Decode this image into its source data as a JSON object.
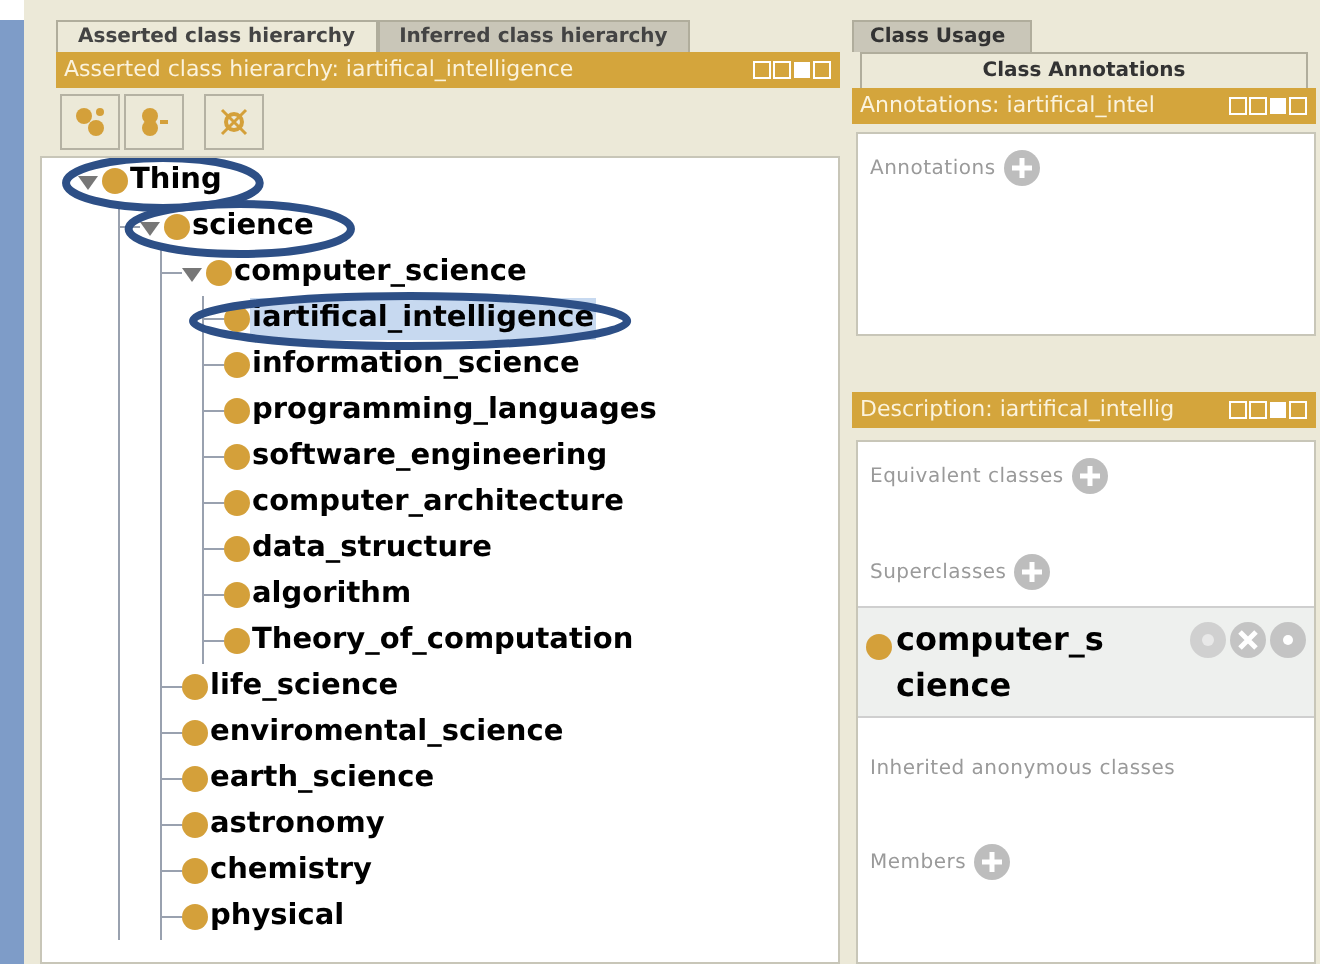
{
  "left_tabs": [
    {
      "label": "Asserted class hierarchy",
      "selected": true
    },
    {
      "label": "Inferred class hierarchy",
      "selected": false
    }
  ],
  "hierarchy_panel": {
    "title": "Asserted class hierarchy: iartifical_intelligence",
    "tools": [
      {
        "kind": "add-subclass"
      },
      {
        "kind": "add-sibling"
      },
      {
        "kind": "delete"
      }
    ],
    "tree": [
      {
        "label": "Thing",
        "expanded": true,
        "selected": false,
        "circled": true,
        "children": [
          {
            "label": "science",
            "expanded": true,
            "selected": false,
            "circled": true,
            "children": [
              {
                "label": "computer_science",
                "expanded": true,
                "selected": false,
                "circled": false,
                "children": [
                  {
                    "label": "iartifical_intelligence",
                    "selected": true,
                    "circled": true
                  },
                  {
                    "label": "information_science",
                    "selected": false,
                    "circled": false
                  },
                  {
                    "label": "programming_languages",
                    "selected": false,
                    "circled": false
                  },
                  {
                    "label": "software_engineering",
                    "selected": false,
                    "circled": false
                  },
                  {
                    "label": "computer_architecture",
                    "selected": false,
                    "circled": false
                  },
                  {
                    "label": "data_structure",
                    "selected": false,
                    "circled": false
                  },
                  {
                    "label": "algorithm",
                    "selected": false,
                    "circled": false
                  },
                  {
                    "label": "Theory_of_computation",
                    "selected": false,
                    "circled": false
                  }
                ]
              },
              {
                "label": "life_science",
                "selected": false,
                "circled": false
              },
              {
                "label": "enviromental_science",
                "selected": false,
                "circled": false
              },
              {
                "label": "earth_science",
                "selected": false,
                "circled": false
              },
              {
                "label": "astronomy",
                "selected": false,
                "circled": false
              },
              {
                "label": "chemistry",
                "selected": false,
                "circled": false
              },
              {
                "label": "physical",
                "selected": false,
                "circled": false
              }
            ]
          }
        ]
      }
    ]
  },
  "right_tabs": [
    {
      "label": "Class Usage",
      "selected": false
    },
    {
      "label": "Class Annotations",
      "selected": true
    }
  ],
  "annotations_panel": {
    "title": "Annotations: iartifical_intel",
    "sections": [
      {
        "label": "Annotations",
        "addable": true
      }
    ]
  },
  "description_panel": {
    "title": "Description: iartifical_intellig",
    "sections": [
      {
        "label": "Equivalent classes",
        "addable": true
      },
      {
        "label": "Superclasses",
        "addable": true,
        "entries": [
          "computer_science"
        ]
      },
      {
        "label": "Inherited anonymous classes",
        "addable": false
      },
      {
        "label": "Members",
        "addable": true
      }
    ]
  }
}
